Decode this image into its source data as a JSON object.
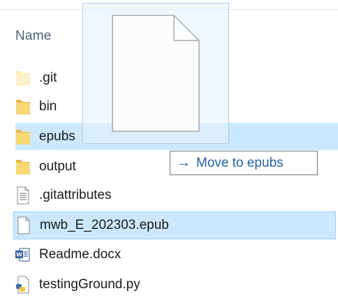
{
  "header": {
    "name_label": "Name"
  },
  "files": [
    {
      "name": ".git",
      "icon": "folder-light-icon"
    },
    {
      "name": "bin",
      "icon": "folder-icon"
    },
    {
      "name": "epubs",
      "icon": "folder-icon",
      "state": "drop-target"
    },
    {
      "name": "output",
      "icon": "folder-icon"
    },
    {
      "name": ".gitattributes",
      "icon": "text-file-icon"
    },
    {
      "name": "mwb_E_202303.epub",
      "icon": "blank-file-icon",
      "state": "selected"
    },
    {
      "name": "Readme.docx",
      "icon": "word-doc-icon"
    },
    {
      "name": "testingGround.py",
      "icon": "python-file-icon"
    }
  ],
  "drop_tip": {
    "arrow": "→",
    "text": "Move to epubs"
  },
  "colors": {
    "selection": "#cce8ff",
    "selection_border": "#99d1ff",
    "folder": "#f8d775",
    "tip_text": "#1f5fa8"
  }
}
